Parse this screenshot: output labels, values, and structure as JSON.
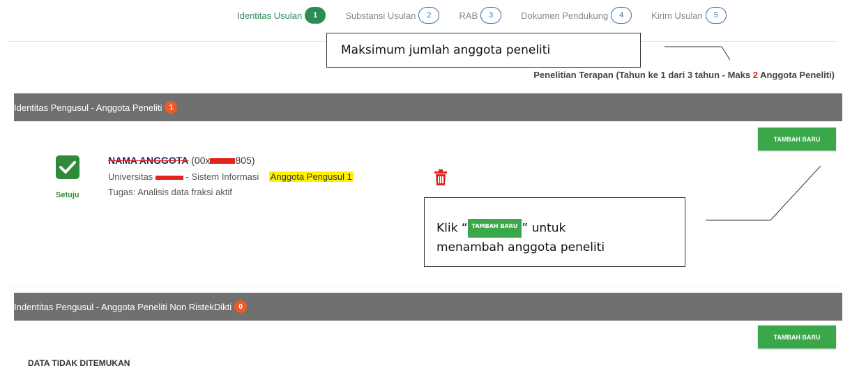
{
  "steps": [
    {
      "label": "Identitas Usulan",
      "num": "1"
    },
    {
      "label": "Substansi Usulan",
      "num": "2"
    },
    {
      "label": "RAB",
      "num": "3"
    },
    {
      "label": "Dokumen Pendukung",
      "num": "4"
    },
    {
      "label": "Kirim Usulan",
      "num": "5"
    }
  ],
  "callout_max": "Maksimum jumlah anggota peneliti",
  "quota": {
    "prefix": "Penelitian Terapan (Tahun ke 1 dari 3 tahun - Maks ",
    "max": "2",
    "suffix": " Anggota Peneliti)"
  },
  "section1": {
    "title": "Identitas Pengusul - Anggota Peneliti",
    "count": "1"
  },
  "section2": {
    "title": "Indentitas Pengusul - Anggota Peneliti Non RistekDikti",
    "count": "0"
  },
  "add_button": "TAMBAH BARU",
  "member": {
    "status": "Setuju",
    "name": "NAMA ANGGOTA",
    "id_open": " (00x",
    "id_close": "805)",
    "institution": "Universitas ",
    "program": " - Sistem Informasi",
    "role": "Anggota Pengusul 1",
    "task": "Tugas: Analisis data fraksi aktif"
  },
  "callout_add": {
    "pre": "Klik “",
    "post": "” untuk",
    "line2": "menambah anggota peneliti"
  },
  "empty_text": "DATA TIDAK DITEMUKAN",
  "colors": {
    "accent_green": "#3aa84a",
    "step_blue": "#3b6ea8",
    "badge_orange": "#f05a28",
    "highlight": "#fff200"
  },
  "icons": [
    "check-icon",
    "trash-icon"
  ]
}
